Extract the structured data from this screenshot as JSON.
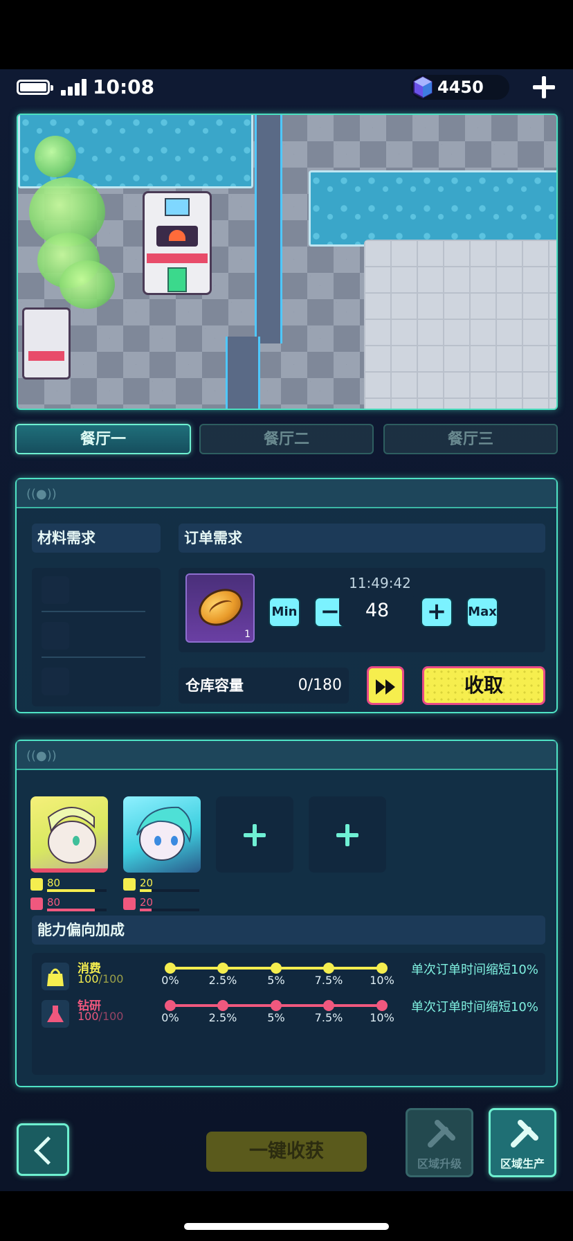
{
  "status_bar": {
    "time": "10:08",
    "gems": "4450"
  },
  "restaurant_tabs": [
    {
      "label": "餐厅一",
      "active": true
    },
    {
      "label": "餐厅二",
      "active": false
    },
    {
      "label": "餐厅三",
      "active": false
    }
  ],
  "production_panel": {
    "materials_title": "材料需求",
    "orders_title": "订单需求",
    "order": {
      "item_icon": "bread-icon",
      "item_count": "1",
      "timer": "11:49:42",
      "quantity": "48",
      "min_label": "Min",
      "max_label": "Max",
      "minus_label": "−",
      "plus_label": "+"
    },
    "storage_label": "仓库容量",
    "storage_value": "0/180",
    "collect_label": "收取"
  },
  "staff_panel": {
    "staff": [
      {
        "consume": "80",
        "research": "80",
        "consume_level": 0.8,
        "research_level": 0.8
      },
      {
        "consume": "20",
        "research": "20",
        "consume_level": 0.2,
        "research_level": 0.2
      }
    ],
    "empty_slot_label": "+",
    "bonus_title": "能力偏向加成",
    "bonus_rows": [
      {
        "name": "消费",
        "value": "100",
        "max": "/100",
        "color": "#f5ee4f",
        "desc": "单次订单时间缩短10%"
      },
      {
        "name": "钻研",
        "value": "100",
        "max": "/100",
        "color": "#f0587e",
        "desc": "单次订单时间缩短10%"
      }
    ],
    "ticks": [
      "0%",
      "2.5%",
      "5%",
      "7.5%",
      "10%"
    ]
  },
  "bottom_bar": {
    "harvest_label": "一键收获",
    "zone_upgrade_label": "区域升级",
    "zone_production_label": "区域生产"
  },
  "colors": {
    "accent": "#4fe3c5",
    "yellow": "#f6ee4e",
    "pink": "#f0587e"
  }
}
